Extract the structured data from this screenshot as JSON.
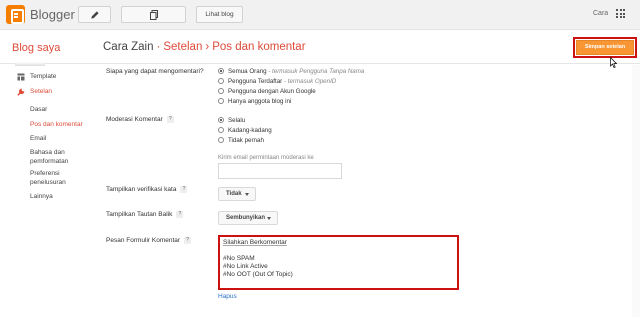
{
  "topbar": {
    "brand": "Blogger",
    "view_blog": "Lihat blog",
    "user": "Cara",
    "icons": [
      "pencil-icon",
      "pages-icon",
      "apps-grid-icon"
    ]
  },
  "header": {
    "blog_saya": "Blog saya",
    "crumb_blog": "Cara Zain",
    "crumb_sep": "·",
    "crumb_settings": "Setelan",
    "crumb_arrow": "›",
    "crumb_page": "Pos dan komentar",
    "save_label": "Simpan setelan"
  },
  "sidebar": {
    "template": "Template",
    "settings": "Setelan",
    "sub_items": [
      "Dasar",
      "Pos dan komentar",
      "Email",
      "Bahasa dan",
      "pemformatan",
      "Preferensi",
      "penelusuran",
      "Lainnya"
    ]
  },
  "settings": {
    "who_can_comment": {
      "label": "Siapa yang dapat mengomentari?",
      "options": [
        {
          "text": "Semua Orang",
          "note": "- termasuk Pengguna Tanpa Nama",
          "selected": true
        },
        {
          "text": "Pengguna Terdaftar",
          "note": "- termasuk OpenID",
          "selected": false
        },
        {
          "text": "Pengguna dengan Akun Google",
          "note": "",
          "selected": false
        },
        {
          "text": "Hanya anggota blog ini",
          "note": "",
          "selected": false
        }
      ]
    },
    "moderation": {
      "label": "Moderasi Komentar",
      "help": "?",
      "options": [
        {
          "text": "Selalu",
          "selected": true
        },
        {
          "text": "Kadang-kadang",
          "selected": false
        },
        {
          "text": "Tidak pernah",
          "selected": false
        }
      ],
      "email_label": "Kirim email permintaan moderasi ke",
      "email_value": ""
    },
    "word_verification": {
      "label": "Tampilkan verifikasi kata",
      "help": "?",
      "value": "Tidak"
    },
    "backlinks": {
      "label": "Tampilkan Tautan Balik",
      "help": "?",
      "value": "Sembunyikan"
    },
    "comment_form": {
      "label": "Pesan Formulir Komentar",
      "help": "?",
      "lines": [
        "Silahkan Berkomentar",
        "",
        "#No SPAM",
        "#No Link Active",
        "#No OOT (Out Of Topic)"
      ],
      "delete_label": "Hapus"
    }
  },
  "colors": {
    "accent": "#dd4b39",
    "save_button": "#f79633",
    "highlight_border": "#cc1111",
    "link": "#2a72c9"
  }
}
